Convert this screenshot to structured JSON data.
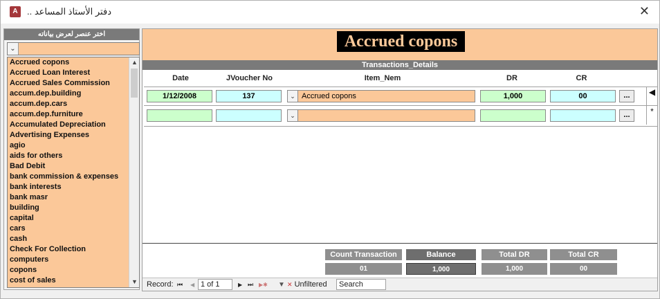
{
  "window": {
    "title": ".. دفتر الأستاذ المساعد",
    "app_icon": "A",
    "close_glyph": "✕"
  },
  "left_panel": {
    "header": "اختر عنصر لعرض بياناته",
    "combo_value": "",
    "items": [
      "Accrued copons",
      "Accrued Loan Interest",
      "Accrued Sales Commission",
      "accum.dep.building",
      "accum.dep.cars",
      "accum.dep.furniture",
      "Accumulated Depreciation",
      "Advertising Expenses",
      "agio",
      "aids for others",
      "Bad Debit",
      "bank commission & expenses",
      "bank interests",
      "bank masr",
      "building",
      "capital",
      "cars",
      "cash",
      "Check For Collection",
      "computers",
      "copons",
      "cost of sales"
    ]
  },
  "form": {
    "title": "Accrued copons",
    "subform_title": "Transactions_Details",
    "columns": {
      "date": "Date",
      "voucher": "JVoucher No",
      "item": "Item_Nem",
      "dr": "DR",
      "cr": "CR"
    },
    "rows": [
      {
        "date": "1/12/2008",
        "voucher": "137",
        "item": "Accrued copons",
        "dr": "1,000",
        "cr": "00",
        "button": "...",
        "selector": "◀"
      },
      {
        "date": "",
        "voucher": "",
        "item": "",
        "dr": "",
        "cr": "",
        "button": "...",
        "selector": "*"
      }
    ],
    "footer": {
      "count_label": "Count Transaction",
      "count_value": "01",
      "balance_label": "Balance",
      "balance_value": "1,000",
      "total_dr_label": "Total  DR",
      "total_dr_value": "1,000",
      "total_cr_label": "Total  CR",
      "total_cr_value": "00"
    },
    "navigation": {
      "record_label": "Record:",
      "first": "⏮",
      "prev": "◀",
      "position": "1 of 1",
      "next": "▶",
      "last": "⏭",
      "new": "▶✱",
      "filter_label": "Unfiltered",
      "search_label": "Search"
    }
  },
  "colors": {
    "accent_orange": "#fbc899",
    "green_cell": "#ccffcc",
    "cyan_cell": "#ccffff",
    "header_gray": "#7a7a7a"
  }
}
